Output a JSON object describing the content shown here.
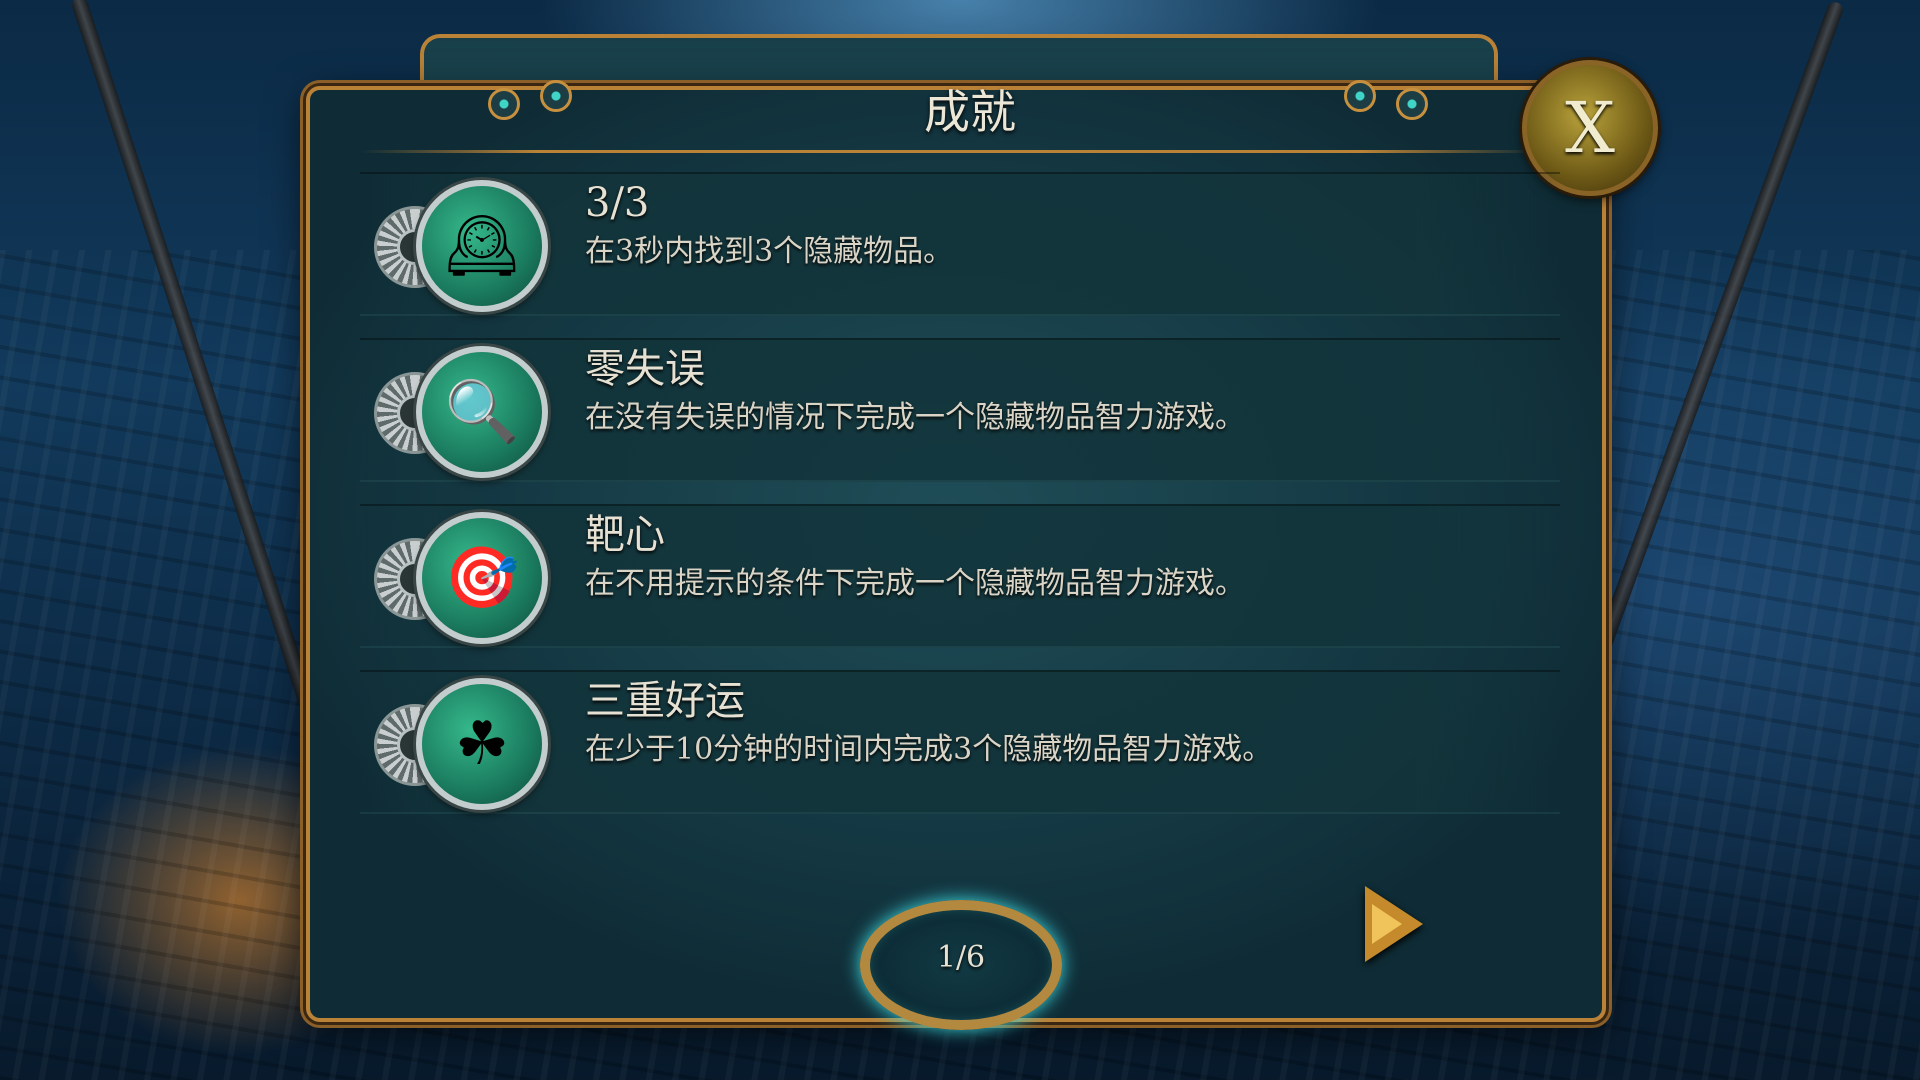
{
  "dialog": {
    "title": "成就",
    "close_label": "X"
  },
  "achievements": [
    {
      "name": "3/3",
      "description": "在3秒内找到3个隐藏物品。",
      "icon": "pocket-watch-icon",
      "glyph": "🕰"
    },
    {
      "name": "零失误",
      "description": "在没有失误的情况下完成一个隐藏物品智力游戏。",
      "icon": "magnifying-glass-icon",
      "glyph": "🔍"
    },
    {
      "name": "靶心",
      "description": "在不用提示的条件下完成一个隐藏物品智力游戏。",
      "icon": "target-arrow-icon",
      "glyph": "🎯"
    },
    {
      "name": "三重好运",
      "description": "在少于10分钟的时间内完成3个隐藏物品智力游戏。",
      "icon": "clover-icon",
      "glyph": "☘"
    }
  ],
  "pager": {
    "label": "1/6"
  },
  "colors": {
    "frame": "#b98237",
    "panel": "#1c4752",
    "medal": "#1a7a5d",
    "text": "#e6e1d2"
  }
}
